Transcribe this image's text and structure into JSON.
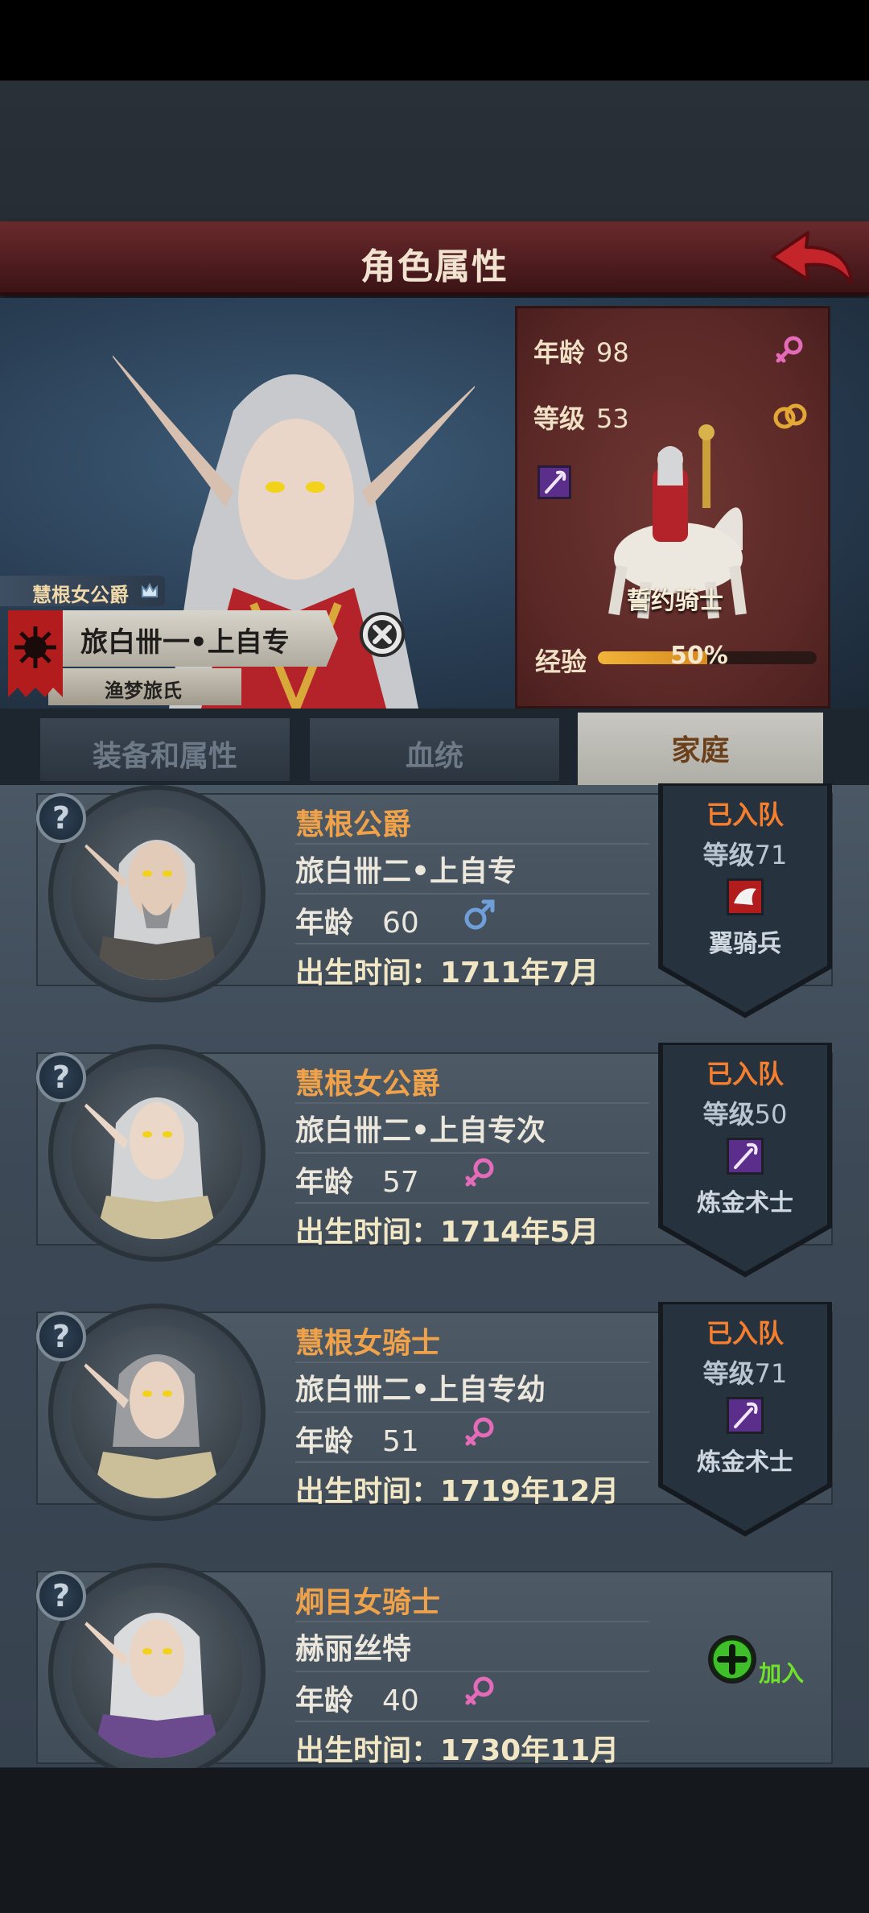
{
  "header": {
    "title": "角色属性"
  },
  "character": {
    "house_title": "慧根女公爵",
    "name": "旅白卌一•上自专",
    "clan": "渔梦旅氏"
  },
  "stats": {
    "age_label": "年龄",
    "age": "98",
    "level_label": "等级",
    "level": "53",
    "class_name": "誓约骑士",
    "xp_label": "经验",
    "xp_text": "50%",
    "xp_progress": 0.5
  },
  "tabs": [
    {
      "label": "装备和属性",
      "active": false
    },
    {
      "label": "血统",
      "active": false
    },
    {
      "label": "家庭",
      "active": true
    }
  ],
  "family": [
    {
      "title": "慧根公爵",
      "name": "旅白卌二•上自专",
      "age_label": "年龄",
      "age": "60",
      "gender": "male",
      "birth": "出生时间：1711年7月",
      "status": "已入队",
      "level_label": "等级",
      "level": "71",
      "class": "翼骑兵"
    },
    {
      "title": "慧根女公爵",
      "name": "旅白卌二•上自专次",
      "age_label": "年龄",
      "age": "57",
      "gender": "female",
      "birth": "出生时间：1714年5月",
      "status": "已入队",
      "level_label": "等级",
      "level": "50",
      "class": "炼金术士"
    },
    {
      "title": "慧根女骑士",
      "name": "旅白卌二•上自专幼",
      "age_label": "年龄",
      "age": "51",
      "gender": "female",
      "birth": "出生时间：1719年12月",
      "status": "已入队",
      "level_label": "等级",
      "level": "71",
      "class": "炼金术士"
    },
    {
      "title": "炯目女骑士",
      "name": "赫丽丝特",
      "age_label": "年龄",
      "age": "40",
      "gender": "female",
      "birth": "出生时间：1730年11月",
      "action": "加入"
    }
  ],
  "icons": {
    "back": "back-arrow-icon",
    "close": "close-icon",
    "female": "female-icon",
    "male": "male-icon",
    "marriage": "rings-icon",
    "staff": "staff-icon",
    "unknown": "question-icon",
    "add": "plus-icon"
  },
  "colors": {
    "accent_orange": "#f0a24a",
    "status_orange": "#f57f2f",
    "add_green": "#6fe22a",
    "title_red": "#4e1c1f"
  }
}
